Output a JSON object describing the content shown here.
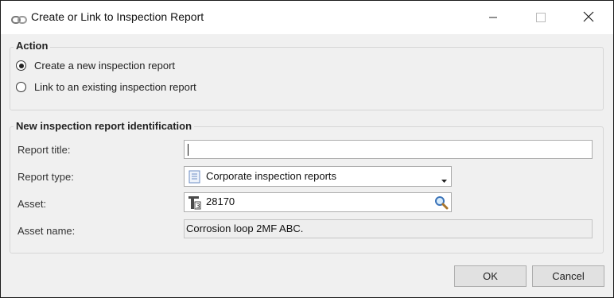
{
  "window": {
    "title": "Create or Link to Inspection Report",
    "title_icon": "chain-link-icon",
    "controls": [
      "minimize-icon",
      "maximize-icon",
      "close-icon"
    ]
  },
  "action": {
    "legend": "Action",
    "options": [
      {
        "label": "Create a new inspection report",
        "checked": true
      },
      {
        "label": "Link to an existing inspection report",
        "checked": false
      }
    ]
  },
  "identification": {
    "legend": "New inspection report identification",
    "report_title": {
      "label": "Report title:",
      "value": ""
    },
    "report_type": {
      "label": "Report type:",
      "value": "Corporate inspection reports",
      "icon": "report-document-icon"
    },
    "asset": {
      "label": "Asset:",
      "value": "28170",
      "icon": "asset-tag-icon",
      "search_icon": "magnifier-icon"
    },
    "asset_name": {
      "label": "Asset name:",
      "value": "Corrosion loop 2MF ABC."
    }
  },
  "buttons": {
    "ok": "OK",
    "cancel": "Cancel"
  }
}
